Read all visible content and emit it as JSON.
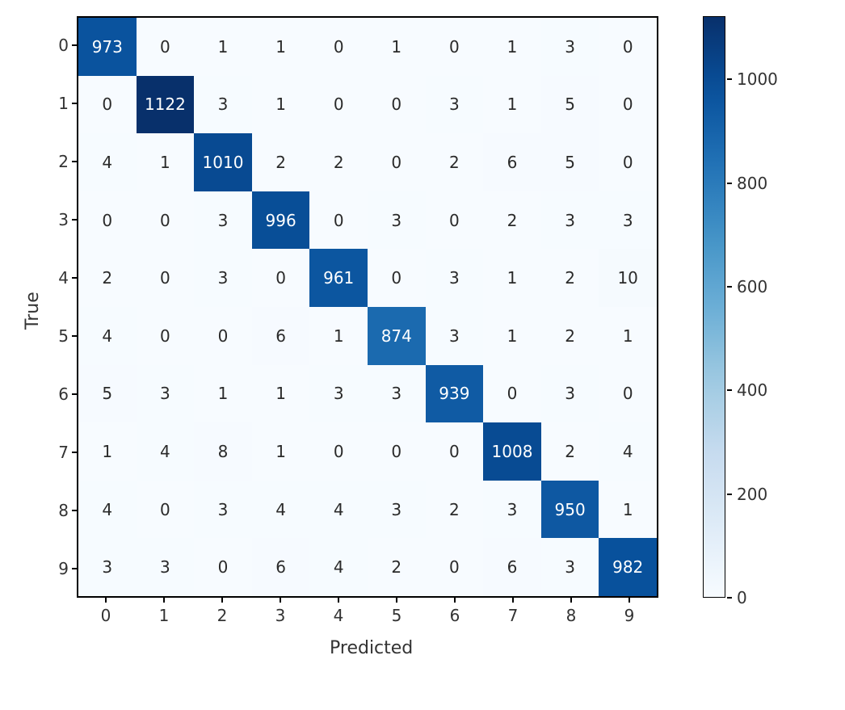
{
  "chart_data": {
    "type": "heatmap",
    "title": "",
    "xlabel": "Predicted",
    "ylabel": "True",
    "x_categories": [
      "0",
      "1",
      "2",
      "3",
      "4",
      "5",
      "6",
      "7",
      "8",
      "9"
    ],
    "y_categories": [
      "0",
      "1",
      "2",
      "3",
      "4",
      "5",
      "6",
      "7",
      "8",
      "9"
    ],
    "values": [
      [
        973,
        0,
        1,
        1,
        0,
        1,
        0,
        1,
        3,
        0
      ],
      [
        0,
        1122,
        3,
        1,
        0,
        0,
        3,
        1,
        5,
        0
      ],
      [
        4,
        1,
        1010,
        2,
        2,
        0,
        2,
        6,
        5,
        0
      ],
      [
        0,
        0,
        3,
        996,
        0,
        3,
        0,
        2,
        3,
        3
      ],
      [
        2,
        0,
        3,
        0,
        961,
        0,
        3,
        1,
        2,
        10
      ],
      [
        4,
        0,
        0,
        6,
        1,
        874,
        3,
        1,
        2,
        1
      ],
      [
        5,
        3,
        1,
        1,
        3,
        3,
        939,
        0,
        3,
        0
      ],
      [
        1,
        4,
        8,
        1,
        0,
        0,
        0,
        1008,
        2,
        4
      ],
      [
        4,
        0,
        3,
        4,
        4,
        3,
        2,
        3,
        950,
        1
      ],
      [
        3,
        3,
        0,
        6,
        4,
        2,
        0,
        6,
        3,
        982
      ]
    ],
    "vmin": 0,
    "vmax": 1122,
    "colorbar_ticks": [
      0,
      200,
      400,
      600,
      800,
      1000
    ],
    "cmap": "Blues"
  }
}
